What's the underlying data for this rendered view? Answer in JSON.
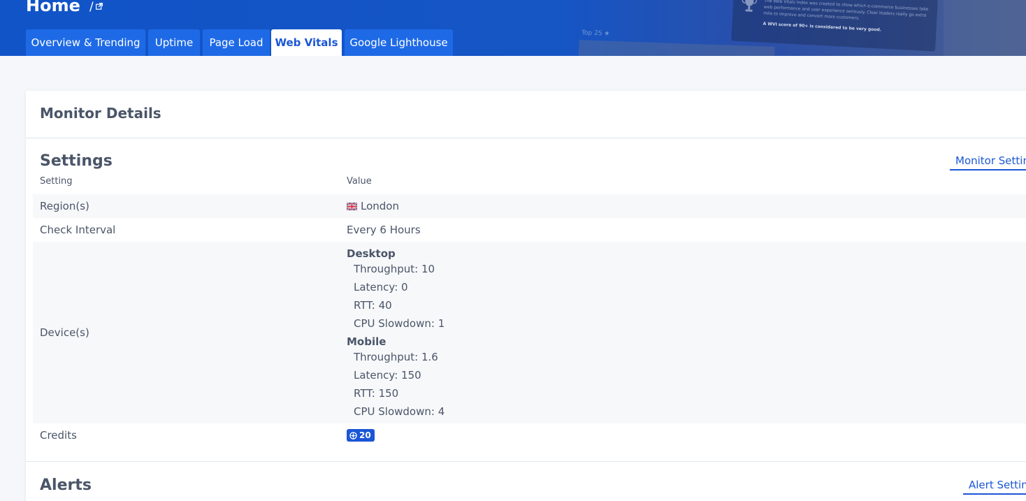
{
  "header": {
    "title": "Home",
    "separator": "/",
    "banner_text": "The Web Vitals Index was created to show which e-commerce businesses take web performance and user experience seriously. Clear leaders really go extra mile to improve and convert more customers.",
    "banner_bold": "A WVI score of 90+ is considered to be very good.",
    "banner_top": "Top 25 ★"
  },
  "tabs": [
    {
      "label": "Overview & Trending"
    },
    {
      "label": "Uptime"
    },
    {
      "label": "Page Load"
    },
    {
      "label": "Web Vitals"
    },
    {
      "label": "Google Lighthouse"
    }
  ],
  "active_tab": "Web Vitals",
  "card": {
    "title": "Monitor Details",
    "settings": {
      "title": "Settings",
      "button_label": "Monitor Settin",
      "col_setting": "Setting",
      "col_value": "Value",
      "region_label": "Region(s)",
      "region_value": "London",
      "interval_label": "Check Interval",
      "interval_value": "Every 6 Hours",
      "devices_label": "Device(s)",
      "desktop": {
        "name": "Desktop",
        "throughput": "Throughput: 10",
        "latency": "Latency: 0",
        "rtt": "RTT: 40",
        "cpu": "CPU Slowdown: 1"
      },
      "mobile": {
        "name": "Mobile",
        "throughput": "Throughput: 1.6",
        "latency": "Latency: 150",
        "rtt": "RTT: 150",
        "cpu": "CPU Slowdown: 4"
      },
      "credits_label": "Credits",
      "credits_value": "20"
    },
    "alerts": {
      "title": "Alerts",
      "button_label": "Alert Settin"
    }
  },
  "colors": {
    "accent": "#1a56d6",
    "header_bg": "#1054c8",
    "tab_bg": "#1e6ae6"
  }
}
